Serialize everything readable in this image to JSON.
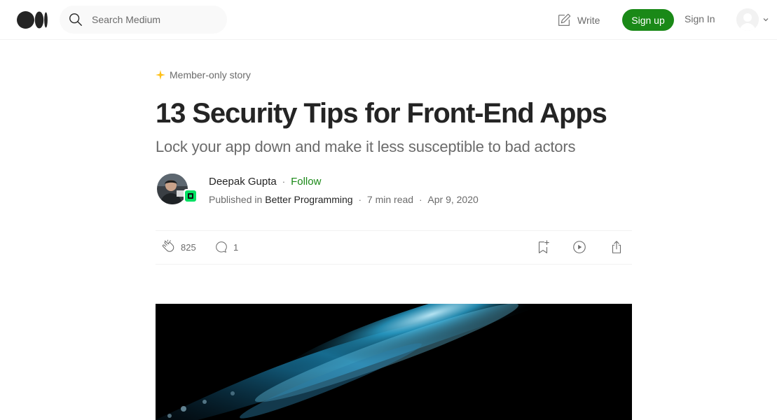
{
  "header": {
    "search_placeholder": "Search Medium",
    "write_label": "Write",
    "signup_label": "Sign up",
    "signin_label": "Sign In"
  },
  "article": {
    "badge_label": "Member-only story",
    "title": "13 Security Tips for Front-End Apps",
    "subtitle": "Lock your app down and make it less susceptible to bad actors",
    "author_name": "Deepak Gupta",
    "follow_label": "Follow",
    "published_in_label": "Published in",
    "publication": "Better Programming",
    "read_time": "7 min read",
    "date": "Apr 9, 2020",
    "clap_count": "825",
    "response_count": "1"
  },
  "colors": {
    "brand_green": "#1a8917",
    "text_primary": "#242424",
    "text_secondary": "#6b6b6b",
    "member_star": "#ffc017",
    "publication_green": "#00e062"
  },
  "icons": [
    "medium-logo",
    "search-icon",
    "write-icon",
    "user-avatar",
    "chevron-down-icon",
    "star-icon",
    "clap-icon",
    "comment-icon",
    "bookmark-add-icon",
    "play-icon",
    "share-icon"
  ]
}
